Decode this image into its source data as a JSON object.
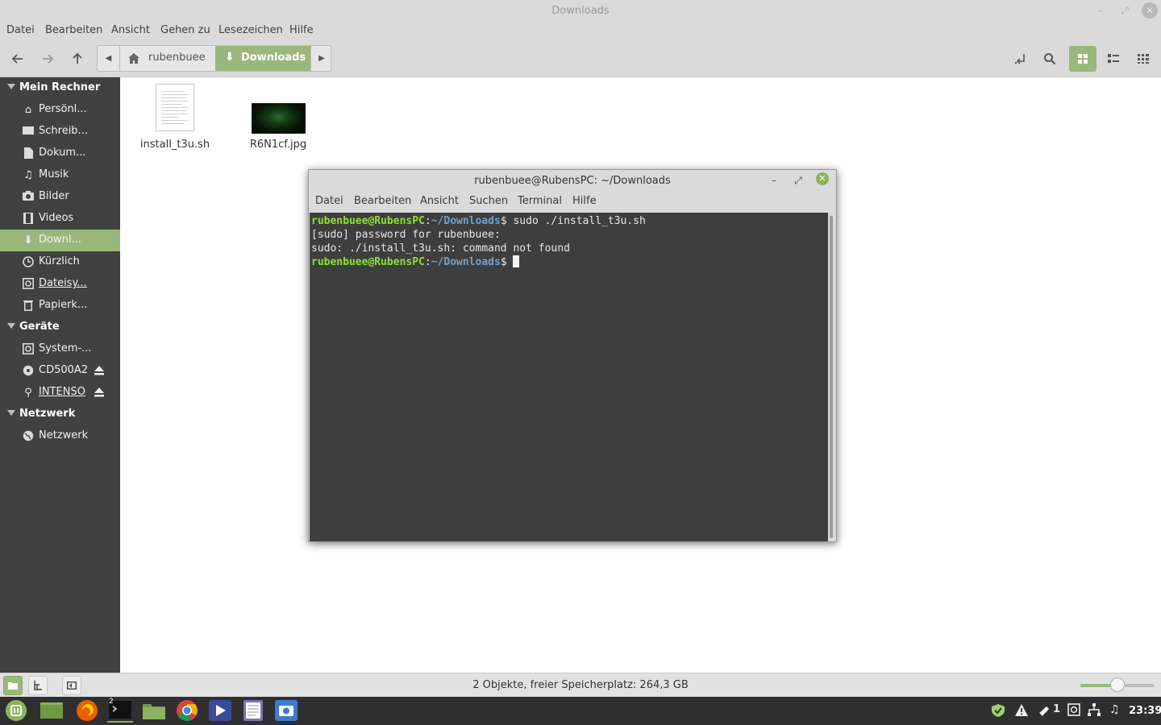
{
  "window": {
    "title": "Downloads"
  },
  "menubar": {
    "items": [
      "Datei",
      "Bearbeiten",
      "Ansicht",
      "Gehen zu",
      "Lesezeichen",
      "Hilfe"
    ]
  },
  "breadcrumb": {
    "home": "rubenbuee",
    "current": "Downloads"
  },
  "sidebar": {
    "sections": [
      {
        "title": "Mein Rechner",
        "items": [
          "Persönl...",
          "Schreib...",
          "Dokum...",
          "Musik",
          "Bilder",
          "Videos",
          "Downl...",
          "Kürzlich",
          "Dateisy...",
          "Papierk..."
        ]
      },
      {
        "title": "Geräte",
        "items": [
          "System-...",
          "CD500A2",
          "INTENSO"
        ]
      },
      {
        "title": "Netzwerk",
        "items": [
          "Netzwerk"
        ]
      }
    ],
    "active_item": "Downl..."
  },
  "files": [
    {
      "name": "install_t3u.sh",
      "type": "text-document-icon"
    },
    {
      "name": "R6N1cf.jpg",
      "type": "image-thumbnail"
    }
  ],
  "status": {
    "text": "2 Objekte, freier Speicherplatz: 264,3 GB",
    "zoom_level": 0.5
  },
  "terminal": {
    "title": "rubenbuee@RubensPC: ~/Downloads",
    "menu": [
      "Datei",
      "Bearbeiten",
      "Ansicht",
      "Suchen",
      "Terminal",
      "Hilfe"
    ],
    "lines": [
      {
        "user": "rubenbuee@RubensPC",
        "sep": ":",
        "path": "~/Downloads",
        "cmd": "$ sudo ./install_t3u.sh"
      },
      {
        "text": "[sudo] password for rubenbuee:"
      },
      {
        "text": "sudo: ./install_t3u.sh: command not found"
      },
      {
        "user": "rubenbuee@RubensPC",
        "sep": ":",
        "path": "~/Downloads",
        "cmd": "$ "
      }
    ]
  },
  "taskbar": {
    "tray_count": "1",
    "clock": "23:39",
    "terminal_badge": "2"
  },
  "colors": {
    "accent": "#9ab87c",
    "sidebar_bg": "#414141",
    "terminal_bg": "#3e3e3e",
    "prompt_user": "#8ae234",
    "prompt_path": "#729fcf"
  }
}
